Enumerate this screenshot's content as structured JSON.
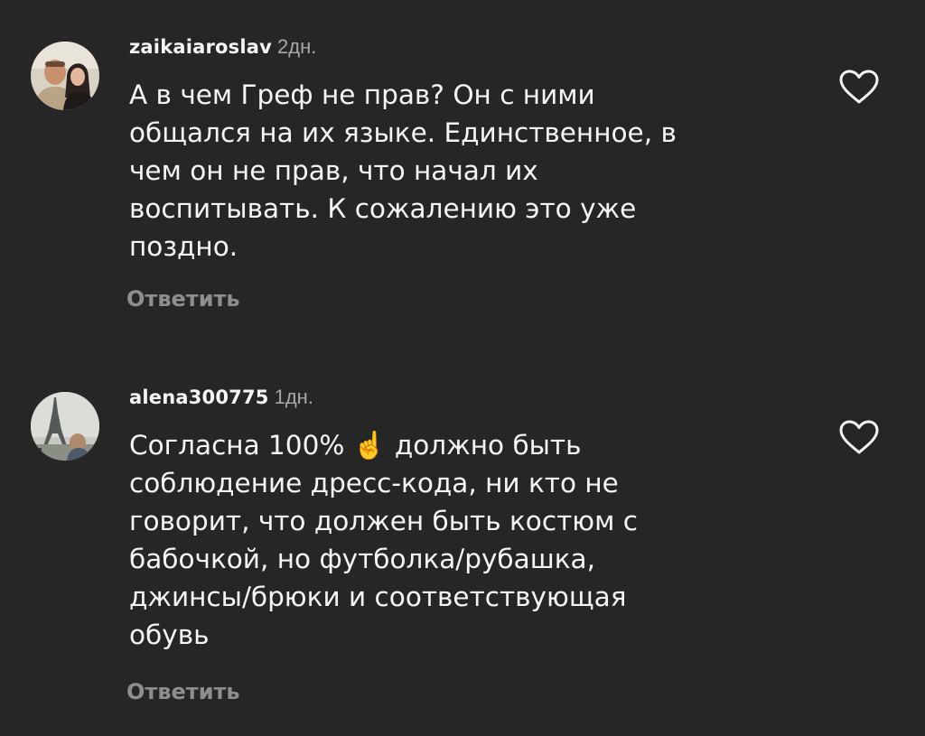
{
  "comments": [
    {
      "username": "zaikaiaroslav",
      "time": "2дн.",
      "text": "А в чем Греф не прав? Он с ними\nобщался на их языке. Единственное, в\nчем он не прав, что начал их\nвоспитывать. К сожалению это уже\nпоздно.",
      "reply_label": "Ответить",
      "avatar_icon": "avatar-couple",
      "like_icon": "heart-outline-icon"
    },
    {
      "username": "alena300775",
      "time": "1дн.",
      "text": "Согласна 100% ☝️ должно быть\nсоблюдение дресс-кода, ни кто не\nговорит, что должен быть костюм с\nбабочкой, но футболка/рубашка,\nджинсы/брюки  и  соответствующая\nобувь",
      "reply_label": "Ответить",
      "avatar_icon": "avatar-eiffel-tower",
      "like_icon": "heart-outline-icon"
    }
  ],
  "colors": {
    "background": "#262626",
    "primary_text": "#f5f5f5",
    "secondary_text": "#a8a8a8",
    "reply_text": "#8e8e8e"
  }
}
